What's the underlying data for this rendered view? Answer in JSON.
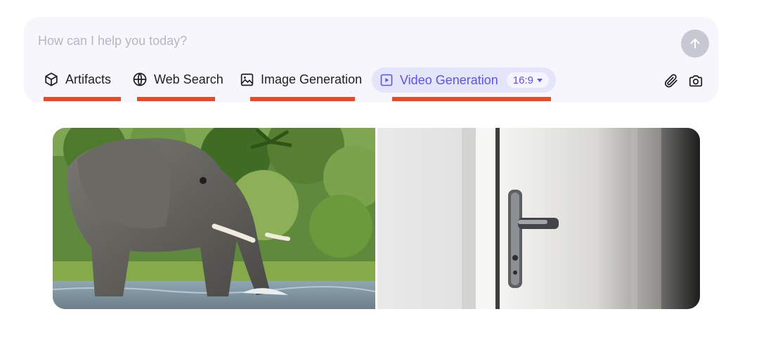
{
  "composer": {
    "placeholder": "How can I help you today?",
    "tools": [
      {
        "label": "Artifacts",
        "icon": "cube-icon"
      },
      {
        "label": "Web Search",
        "icon": "globe-icon"
      },
      {
        "label": "Image Generation",
        "icon": "image-icon"
      },
      {
        "label": "Video Generation",
        "icon": "play-square-icon",
        "active": true
      }
    ],
    "video_aspect_ratio": "16:9",
    "actions": [
      "paperclip-icon",
      "camera-icon",
      "arrow-up-icon"
    ]
  },
  "gallery": {
    "images": [
      {
        "subject": "elephant",
        "icon": "elephant-photo"
      },
      {
        "subject": "door handle",
        "icon": "door-handle-photo"
      }
    ]
  },
  "colors": {
    "accent": "#5b55e0",
    "active_tool_bg": "#e4e4fb",
    "composer_bg": "#f6f6fc",
    "underline": "#e8492a",
    "send_button": "#c7c8d3"
  }
}
